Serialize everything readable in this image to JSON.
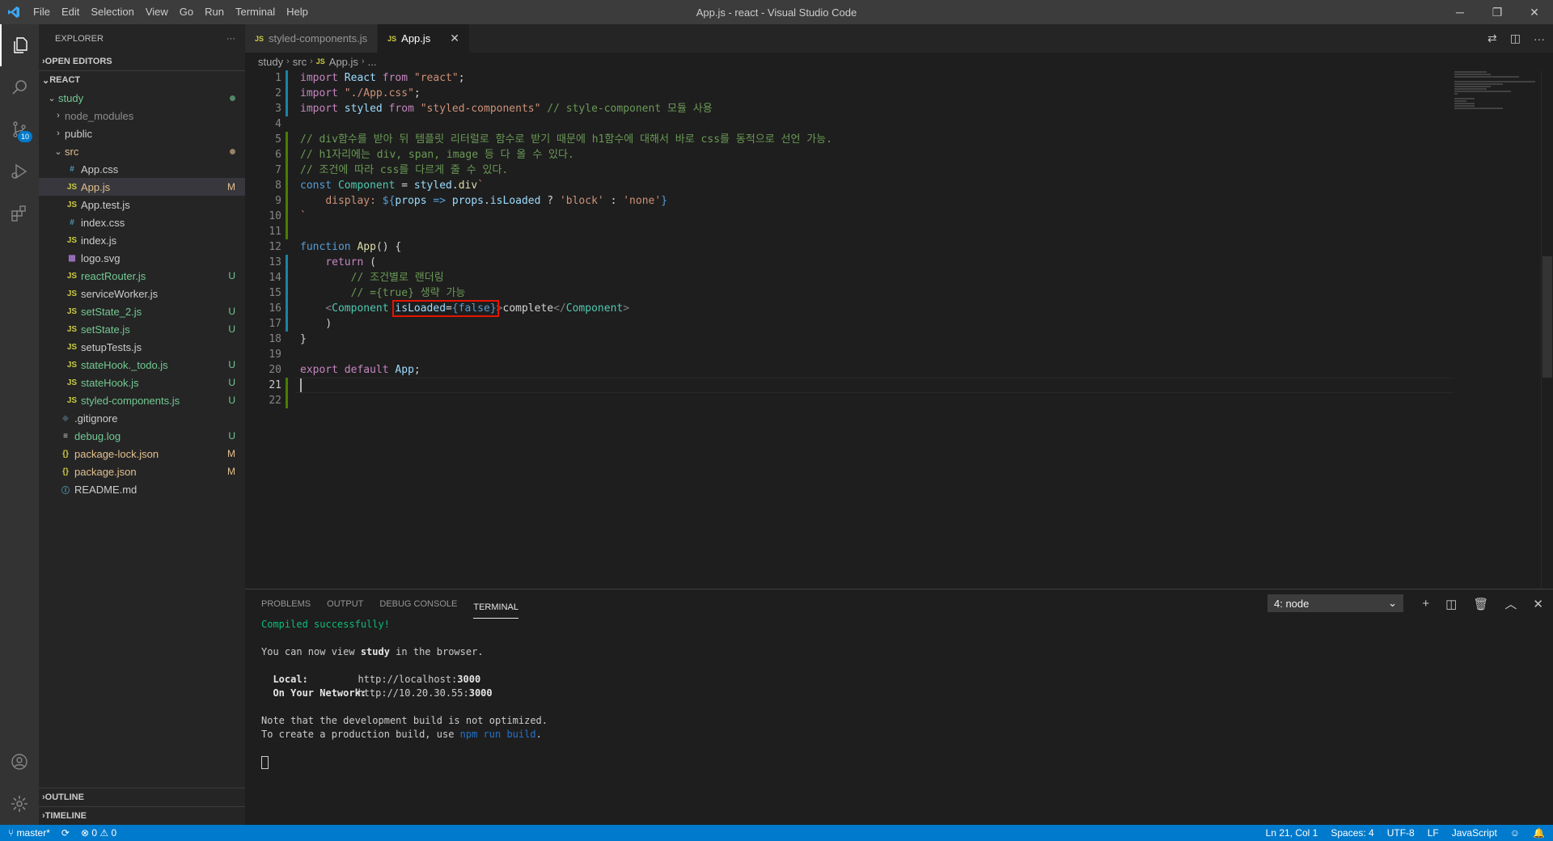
{
  "window": {
    "title": "App.js - react - Visual Studio Code"
  },
  "menu": [
    "File",
    "Edit",
    "Selection",
    "View",
    "Go",
    "Run",
    "Terminal",
    "Help"
  ],
  "activity": {
    "scm_badge": "10"
  },
  "explorer": {
    "title": "EXPLORER",
    "open_editors": "OPEN EDITORS",
    "root": "REACT",
    "items": [
      {
        "name": "study",
        "type": "folder",
        "open": true,
        "indent": 1,
        "status": "dot-untracked"
      },
      {
        "name": "node_modules",
        "type": "folder",
        "open": false,
        "indent": 2,
        "status": "dim"
      },
      {
        "name": "public",
        "type": "folder",
        "open": false,
        "indent": 2,
        "status": ""
      },
      {
        "name": "src",
        "type": "folder",
        "open": true,
        "indent": 2,
        "status": "dot-modified"
      },
      {
        "name": "App.css",
        "type": "css",
        "indent": 3,
        "status": ""
      },
      {
        "name": "App.js",
        "type": "js",
        "indent": 3,
        "status": "M",
        "selected": true
      },
      {
        "name": "App.test.js",
        "type": "js",
        "indent": 3,
        "status": ""
      },
      {
        "name": "index.css",
        "type": "css",
        "indent": 3,
        "status": ""
      },
      {
        "name": "index.js",
        "type": "js",
        "indent": 3,
        "status": ""
      },
      {
        "name": "logo.svg",
        "type": "svg",
        "indent": 3,
        "status": ""
      },
      {
        "name": "reactRouter.js",
        "type": "js",
        "indent": 3,
        "status": "U"
      },
      {
        "name": "serviceWorker.js",
        "type": "js",
        "indent": 3,
        "status": ""
      },
      {
        "name": "setState_2.js",
        "type": "js",
        "indent": 3,
        "status": "U"
      },
      {
        "name": "setState.js",
        "type": "js",
        "indent": 3,
        "status": "U"
      },
      {
        "name": "setupTests.js",
        "type": "js",
        "indent": 3,
        "status": ""
      },
      {
        "name": "stateHook._todo.js",
        "type": "js",
        "indent": 3,
        "status": "U"
      },
      {
        "name": "stateHook.js",
        "type": "js",
        "indent": 3,
        "status": "U"
      },
      {
        "name": "styled-components.js",
        "type": "js",
        "indent": 3,
        "status": "U"
      },
      {
        "name": ".gitignore",
        "type": "git",
        "indent": 2,
        "status": ""
      },
      {
        "name": "debug.log",
        "type": "log",
        "indent": 2,
        "status": "U"
      },
      {
        "name": "package-lock.json",
        "type": "json",
        "indent": 2,
        "status": "M"
      },
      {
        "name": "package.json",
        "type": "json",
        "indent": 2,
        "status": "M"
      },
      {
        "name": "README.md",
        "type": "info",
        "indent": 2,
        "status": ""
      }
    ],
    "outline": "OUTLINE",
    "timeline": "TIMELINE"
  },
  "tabs": [
    {
      "label": "styled-components.js",
      "active": false
    },
    {
      "label": "App.js",
      "active": true
    }
  ],
  "breadcrumbs": [
    "study",
    "src",
    "App.js",
    "..."
  ],
  "code": {
    "current_line": 21,
    "lines": [
      {
        "n": "1",
        "mark": "mod"
      },
      {
        "n": "2",
        "mark": "mod"
      },
      {
        "n": "3",
        "mark": "mod"
      },
      {
        "n": "4",
        "mark": ""
      },
      {
        "n": "5",
        "mark": "add"
      },
      {
        "n": "6",
        "mark": "add"
      },
      {
        "n": "7",
        "mark": "add"
      },
      {
        "n": "8",
        "mark": "add"
      },
      {
        "n": "9",
        "mark": "add"
      },
      {
        "n": "10",
        "mark": "add"
      },
      {
        "n": "11",
        "mark": "add"
      },
      {
        "n": "12",
        "mark": ""
      },
      {
        "n": "13",
        "mark": "mod"
      },
      {
        "n": "14",
        "mark": "mod"
      },
      {
        "n": "15",
        "mark": "mod"
      },
      {
        "n": "16",
        "mark": "mod"
      },
      {
        "n": "17",
        "mark": "mod"
      },
      {
        "n": "18",
        "mark": ""
      },
      {
        "n": "19",
        "mark": ""
      },
      {
        "n": "20",
        "mark": ""
      },
      {
        "n": "21",
        "mark": "add"
      },
      {
        "n": "22",
        "mark": "add"
      }
    ],
    "l1": {
      "kw": "import",
      "id": "React",
      "from": "from",
      "s": "\"react\"",
      "end": ";"
    },
    "l2": {
      "kw": "import",
      "s": "\"./App.css\"",
      "end": ";"
    },
    "l3": {
      "kw": "import",
      "id": "styled",
      "from": "from",
      "s": "\"styled-components\"",
      "cm": "// style-component 모듈 사용"
    },
    "l5": "// div함수를 받아 뒤 템플릿 리터럴로 함수로 받기 때문에 h1함수에 대해서 바로 css를 동적으로 선언 가능.",
    "l6": "// h1자리에는 div, span, image 등 다 올 수 있다.",
    "l7": "// 조건에 따라 css를 다르게 줄 수 있다.",
    "l8": {
      "kw": "const",
      "id": "Component",
      "eq": " = ",
      "obj": "styled",
      "dot": ".",
      "prop": "div",
      "tick": "`"
    },
    "l9": {
      "prop": "display:",
      "open": "${",
      "arg": "props",
      "arrow": "=>",
      "obj": "props",
      "key": "isLoaded",
      "q": " ? ",
      "a": "'block'",
      "c": " : ",
      "b": "'none'",
      "close": "}"
    },
    "l10": "`",
    "l12": {
      "kw": "function",
      "fn": "App",
      "rest": "() {"
    },
    "l13": {
      "kw": "return",
      "rest": " ("
    },
    "l14": "// 조건별로 랜더링",
    "l15": "// ={true} 생략 가능",
    "l16": {
      "lt": "<",
      "tag": "Component",
      "attr": "isLoaded",
      "eq": "=",
      "open": "{",
      "val": "false",
      "close": "}",
      "gt": ">",
      "text": "complete",
      "end_open": "</",
      "end_tag": "Component",
      "end_gt": ">"
    },
    "l17": ")",
    "l18": "}",
    "l20": {
      "kw": "export",
      "kw2": "default",
      "id": "App",
      "end": ";"
    }
  },
  "panel": {
    "tabs": [
      "PROBLEMS",
      "OUTPUT",
      "DEBUG CONSOLE",
      "TERMINAL"
    ],
    "active_tab": "TERMINAL",
    "terminal_select": "4: node",
    "lines": {
      "compiled": "Compiled successfully!",
      "view_prefix": "You can now view ",
      "view_app": "study",
      "view_suffix": " in the browser.",
      "local_label": "Local:",
      "local_url_pre": "http://localhost:",
      "local_port": "3000",
      "net_label": "On Your Network:",
      "net_url_pre": "http://10.20.30.55:",
      "net_port": "3000",
      "note": "Note that the development build is not optimized.",
      "create_pre": "To create a production build, use ",
      "create_cmd": "npm run build",
      "create_post": "."
    }
  },
  "status": {
    "branch": "master*",
    "errors": "0",
    "warnings": "0",
    "position": "Ln 21, Col 1",
    "spaces": "Spaces: 4",
    "encoding": "UTF-8",
    "eol": "LF",
    "language": "JavaScript"
  },
  "colors": {
    "accent": "#007acc",
    "highlight_box": "#e51400"
  }
}
